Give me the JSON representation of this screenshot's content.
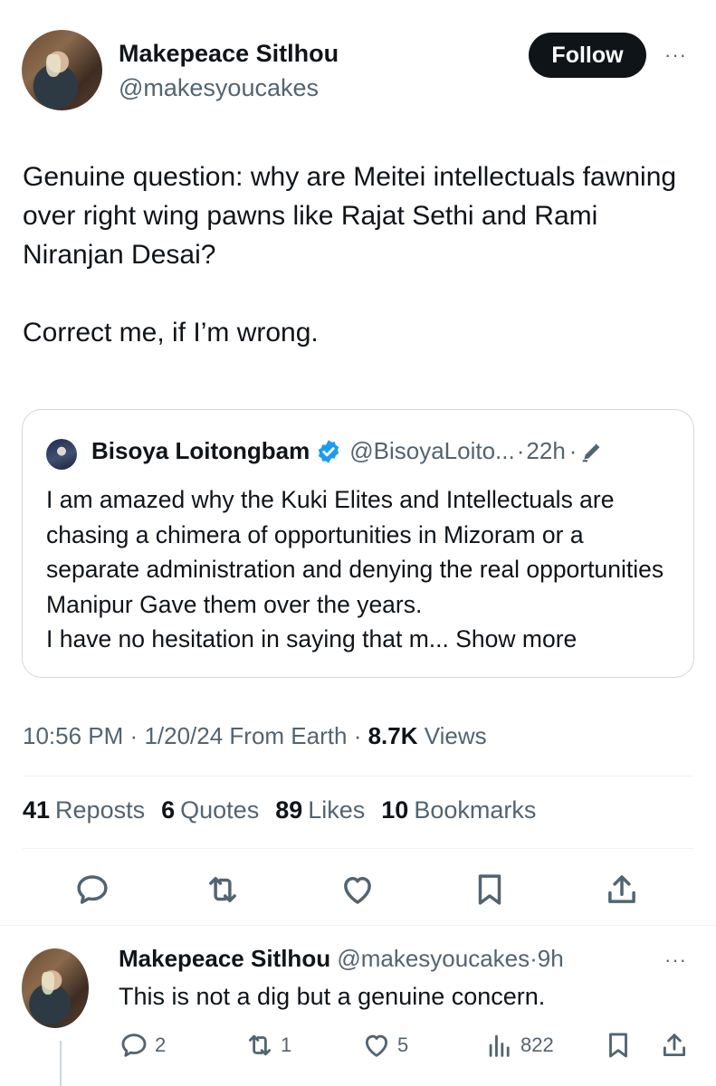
{
  "author": {
    "name": "Makepeace Sitlhou",
    "handle": "@makesyoucakes",
    "follow_label": "Follow",
    "more_label": "···"
  },
  "tweet": {
    "text": "Genuine question: why are Meitei intellectuals fawning over right wing pawns like Rajat Sethi and Rami Niranjan Desai?\n\nCorrect me, if I’m wrong."
  },
  "quote": {
    "name": "Bisoya Loitongbam",
    "handle": "@BisoyaLoito...",
    "sep1": "·",
    "time": "22h",
    "sep2": "·",
    "verified_icon": "verified-badge-icon",
    "edit_icon": "pencil-icon",
    "text": "I am amazed why the Kuki Elites and Intellectuals are chasing a chimera of opportunities in Mizoram or a separate administration and denying the real opportunities Manipur Gave them over the years.\nI have no hesitation in saying that m...",
    "show_more": "Show more"
  },
  "meta": {
    "time": "10:56 PM",
    "sep1": "·",
    "date": "1/20/24",
    "source": "From Earth",
    "sep2": "·",
    "views_count": "8.7K",
    "views_label": "Views"
  },
  "stats": [
    {
      "count": "41",
      "label": "Reposts"
    },
    {
      "count": "6",
      "label": "Quotes"
    },
    {
      "count": "89",
      "label": "Likes"
    },
    {
      "count": "10",
      "label": "Bookmarks"
    }
  ],
  "actions": [
    "reply-icon",
    "repost-icon",
    "like-icon",
    "bookmark-icon",
    "share-icon"
  ],
  "reply": {
    "name": "Makepeace Sitlhou",
    "handle": "@makesyoucakes",
    "sep": "·",
    "time": "9h",
    "text": "This is not a dig but a genuine concern.",
    "replies": "2",
    "reposts": "1",
    "likes": "5",
    "views": "822"
  },
  "colors": {
    "text": "#0f1419",
    "muted": "#536471",
    "border": "#cfd9de",
    "verified": "#1d9bf0"
  }
}
